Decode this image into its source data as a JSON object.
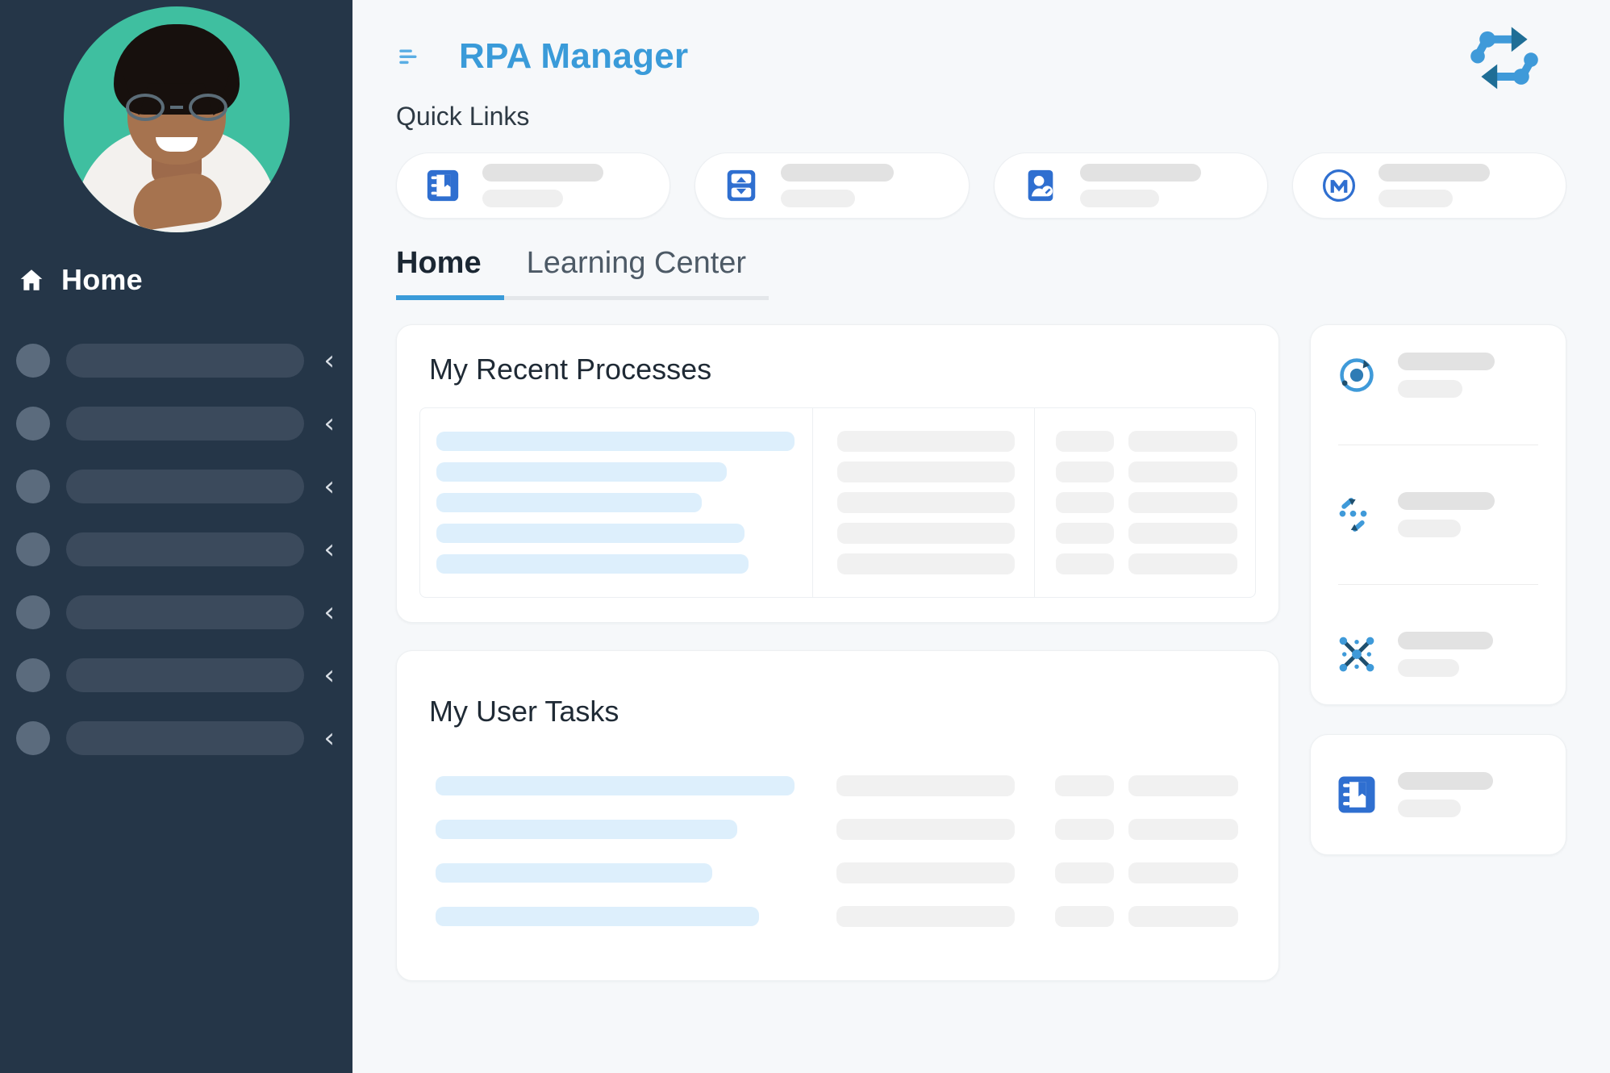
{
  "sidebar": {
    "avatar": {
      "icon": "user-avatar-photo",
      "background_color": "#3fbfa0"
    },
    "home": {
      "icon": "home-icon",
      "label": "Home"
    },
    "nav_items": [
      {
        "icon": "skeleton-dot",
        "label": "",
        "chevron": "‹"
      },
      {
        "icon": "skeleton-dot",
        "label": "",
        "chevron": "‹"
      },
      {
        "icon": "skeleton-dot",
        "label": "",
        "chevron": "‹"
      },
      {
        "icon": "skeleton-dot",
        "label": "",
        "chevron": "‹"
      },
      {
        "icon": "skeleton-dot",
        "label": "",
        "chevron": "‹"
      },
      {
        "icon": "skeleton-dot",
        "label": "",
        "chevron": "‹"
      },
      {
        "icon": "skeleton-dot",
        "label": "",
        "chevron": "‹"
      }
    ],
    "background_color": "#253648"
  },
  "header": {
    "menu_icon": "hamburger-menu-icon",
    "title": "RPA Manager",
    "title_color": "#3a9bd9",
    "logo_icon": "rpa-cycle-logo"
  },
  "quick_links": {
    "heading": "Quick Links",
    "items": [
      {
        "icon": "notebook-bookmark-icon",
        "label": "",
        "sublabel": ""
      },
      {
        "icon": "split-expand-icon",
        "label": "",
        "sublabel": ""
      },
      {
        "icon": "user-edit-icon",
        "label": "",
        "sublabel": ""
      },
      {
        "icon": "mulesoft-logo-icon",
        "label": "",
        "sublabel": ""
      }
    ]
  },
  "tabs": [
    {
      "label": "Home",
      "active": true
    },
    {
      "label": "Learning Center",
      "active": false
    }
  ],
  "main": {
    "recent_processes": {
      "title": "My Recent Processes",
      "bordered": true,
      "rows": [
        {
          "name_width": "100%"
        },
        {
          "name_width": "81%"
        },
        {
          "name_width": "74%"
        },
        {
          "name_width": "86%"
        },
        {
          "name_width": "87%"
        }
      ]
    },
    "user_tasks": {
      "title": "My User Tasks",
      "bordered": false,
      "rows": [
        {
          "name_width": "100%"
        },
        {
          "name_width": "84%"
        },
        {
          "name_width": "77%"
        },
        {
          "name_width": "90%"
        }
      ]
    }
  },
  "right_rail": {
    "cards": [
      {
        "items": [
          {
            "icon": "target-orbit-icon",
            "label": "",
            "sublabel": ""
          },
          {
            "icon": "process-cycle-icon",
            "label": "",
            "sublabel": ""
          },
          {
            "icon": "network-hub-icon",
            "label": "",
            "sublabel": ""
          }
        ]
      },
      {
        "items": [
          {
            "icon": "notebook-bookmark-icon",
            "label": "",
            "sublabel": ""
          }
        ]
      }
    ]
  },
  "colors": {
    "accent_blue": "#3a9bd9",
    "icon_blue": "#2f6fd0",
    "sidebar_bg": "#253648",
    "page_bg": "#f6f8fa",
    "skeleton_blue": "#ddeffc",
    "skeleton_gray": "#e2e2e2"
  }
}
